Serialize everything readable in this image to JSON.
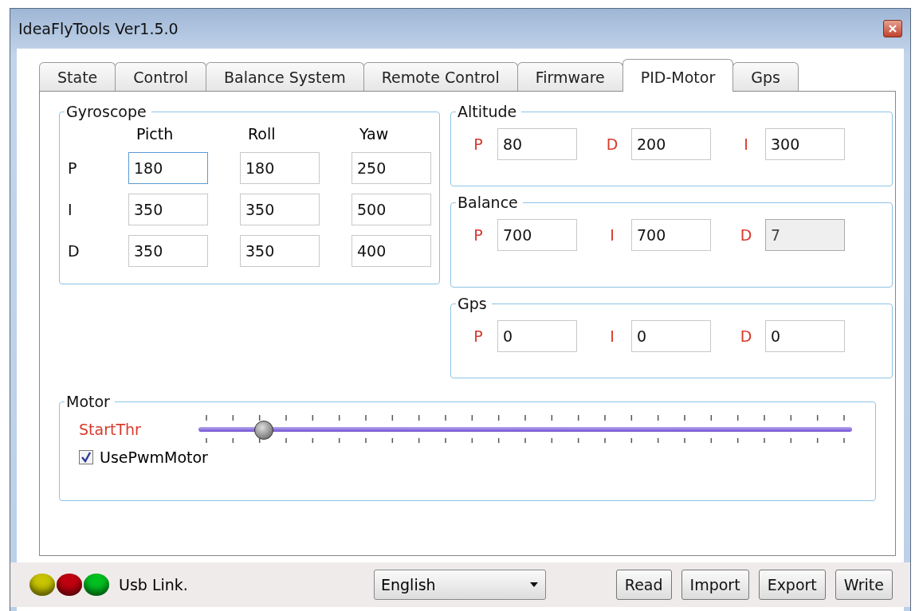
{
  "window": {
    "title": "IdeaFlyTools Ver1.5.0"
  },
  "tabs": [
    {
      "label": "State",
      "selected": false
    },
    {
      "label": "Control",
      "selected": false
    },
    {
      "label": "Balance System",
      "selected": false
    },
    {
      "label": "Remote Control",
      "selected": false
    },
    {
      "label": "Firmware",
      "selected": false
    },
    {
      "label": "PID-Motor",
      "selected": true
    },
    {
      "label": "Gps",
      "selected": false
    }
  ],
  "gyroscope": {
    "title": "Gyroscope",
    "columns": [
      "Picth",
      "Roll",
      "Yaw"
    ],
    "rows": [
      {
        "label": "P",
        "fields": [
          {
            "value": "180",
            "focused": true
          },
          {
            "value": "180",
            "focused": false
          },
          {
            "value": "250",
            "focused": false
          }
        ]
      },
      {
        "label": "I",
        "fields": [
          {
            "value": "350",
            "focused": false
          },
          {
            "value": "350",
            "focused": false
          },
          {
            "value": "500",
            "focused": false
          }
        ]
      },
      {
        "label": "D",
        "fields": [
          {
            "value": "350",
            "focused": false
          },
          {
            "value": "350",
            "focused": false
          },
          {
            "value": "400",
            "focused": false
          }
        ]
      }
    ]
  },
  "groups": [
    {
      "title": "Altitude",
      "params": [
        {
          "label": "P",
          "value": "80",
          "disabled": false
        },
        {
          "label": "D",
          "value": "200",
          "disabled": false
        },
        {
          "label": "I",
          "value": "300",
          "disabled": false
        }
      ]
    },
    {
      "title": "Balance",
      "params": [
        {
          "label": "P",
          "value": "700",
          "disabled": false
        },
        {
          "label": "I",
          "value": "700",
          "disabled": false
        },
        {
          "label": "D",
          "value": "7",
          "disabled": true
        }
      ]
    },
    {
      "title": "Gps",
      "params": [
        {
          "label": "P",
          "value": "0",
          "disabled": false
        },
        {
          "label": "I",
          "value": "0",
          "disabled": false
        },
        {
          "label": "D",
          "value": "0",
          "disabled": false
        }
      ]
    }
  ],
  "motor": {
    "title": "Motor",
    "slider": {
      "label": "StartThr",
      "level": 0.09
    },
    "checkbox": {
      "label": "UsePwmMotor",
      "checked": true
    }
  },
  "status_bar": {
    "lights": [
      {
        "color": "#c8c400"
      },
      {
        "color": "#c00010"
      },
      {
        "color": "#00c020"
      }
    ],
    "text": "Usb Link.",
    "language": "English",
    "buttons": [
      "Read",
      "Import",
      "Export",
      "Write"
    ]
  }
}
